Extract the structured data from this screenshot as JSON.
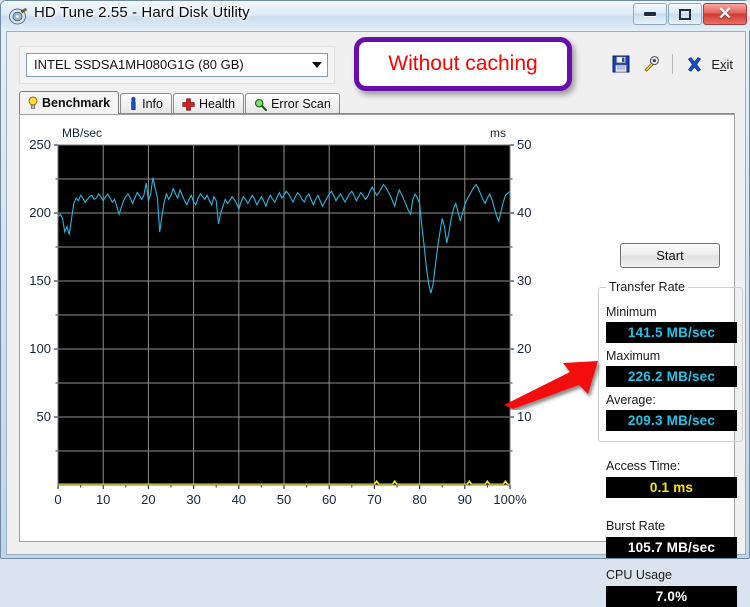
{
  "window": {
    "title": "HD Tune 2.55 - Hard Disk Utility",
    "app_icon": "hard-disk-icon",
    "controls": {
      "minimize": "minimize-icon",
      "maximize": "maximize-icon",
      "close": "✕"
    }
  },
  "toolbar": {
    "drive_selected": "INTEL SSDSA1MH080G1G (80 GB)",
    "save_icon": "floppy-save-icon",
    "tools_icon": "wrench-tools-icon",
    "exit_icon": "close-x-icon",
    "exit_label": "Exit"
  },
  "tabs": [
    {
      "label": "Benchmark",
      "icon": "lightbulb-icon",
      "active": true
    },
    {
      "label": "Info",
      "icon": "info-icon",
      "active": false
    },
    {
      "label": "Health",
      "icon": "red-cross-icon",
      "active": false
    },
    {
      "label": "Error Scan",
      "icon": "magnifier-icon",
      "active": false
    }
  ],
  "actions": {
    "start_label": "Start"
  },
  "stats": {
    "transfer_rate_group": "Transfer Rate",
    "minimum_label": "Minimum",
    "minimum_value": "141.5 MB/sec",
    "maximum_label": "Maximum",
    "maximum_value": "226.2 MB/sec",
    "average_label": "Average:",
    "average_value": "209.3 MB/sec",
    "access_time_label": "Access Time:",
    "access_time_value": "0.1 ms",
    "burst_rate_label": "Burst Rate",
    "burst_rate_value": "105.7 MB/sec",
    "cpu_usage_label": "CPU Usage",
    "cpu_usage_value": "7.0%"
  },
  "annotation": {
    "text": "Without caching",
    "border_color": "#6a0dad",
    "text_color": "#ff0000",
    "arrow_color": "#ff0000",
    "arrow_target": "access-time-value"
  },
  "colors": {
    "transfer_curve": "#29b6dd",
    "access_curve": "#f2e700",
    "plot_background": "#000000",
    "grid": "#8f8f8f",
    "value_cyan": "#22c3e6",
    "value_yellow": "#ffe400",
    "value_white": "#ffffff"
  },
  "chart_data": {
    "type": "line",
    "title": "",
    "xlabel": "",
    "ylabel": "MB/sec",
    "y2label": "ms",
    "xlim": [
      0,
      100
    ],
    "ylim": [
      0,
      250
    ],
    "y2lim": [
      0,
      50
    ],
    "grid": true,
    "x_ticks": [
      0,
      10,
      20,
      30,
      40,
      50,
      60,
      70,
      80,
      90,
      100
    ],
    "x_tick_labels": [
      "0",
      "10",
      "20",
      "30",
      "40",
      "50",
      "60",
      "70",
      "80",
      "90",
      "100%"
    ],
    "y_ticks": [
      50,
      100,
      150,
      200,
      250
    ],
    "y_tick_labels": [
      "50",
      "100",
      "150",
      "200",
      "250"
    ],
    "y2_ticks": [
      10,
      20,
      30,
      40,
      50
    ],
    "y2_tick_labels": [
      "10",
      "20",
      "30",
      "40",
      "50"
    ],
    "series": [
      {
        "name": "Transfer rate",
        "axis": "left",
        "units": "MB/sec",
        "color": "#29b6dd",
        "x": [
          0,
          0.5,
          1,
          1.5,
          2,
          2.5,
          3,
          3.5,
          4,
          4.5,
          5,
          5.5,
          6,
          6.5,
          7,
          7.5,
          8,
          8.5,
          9,
          9.5,
          10,
          10.5,
          11,
          11.5,
          12,
          12.5,
          13,
          13.5,
          14,
          14.5,
          15,
          15.5,
          16,
          16.5,
          17,
          17.5,
          18,
          18.5,
          19,
          19.5,
          20,
          20.5,
          21,
          21.5,
          22,
          22.5,
          23,
          23.5,
          24,
          24.5,
          25,
          25.5,
          26,
          26.5,
          27,
          27.5,
          28,
          28.5,
          29,
          29.5,
          30,
          30.5,
          31,
          31.5,
          32,
          32.5,
          33,
          33.5,
          34,
          34.5,
          35,
          35.5,
          36,
          36.5,
          37,
          37.5,
          38,
          38.5,
          39,
          39.5,
          40,
          40.5,
          41,
          41.5,
          42,
          42.5,
          43,
          43.5,
          44,
          44.5,
          45,
          45.5,
          46,
          46.5,
          47,
          47.5,
          48,
          48.5,
          49,
          49.5,
          50,
          50.5,
          51,
          51.5,
          52,
          52.5,
          53,
          53.5,
          54,
          54.5,
          55,
          55.5,
          56,
          56.5,
          57,
          57.5,
          58,
          58.5,
          59,
          59.5,
          60,
          60.5,
          61,
          61.5,
          62,
          62.5,
          63,
          63.5,
          64,
          64.5,
          65,
          65.5,
          66,
          66.5,
          67,
          67.5,
          68,
          68.5,
          69,
          69.5,
          70,
          70.5,
          71,
          71.5,
          72,
          72.5,
          73,
          73.5,
          74,
          74.5,
          75,
          75.5,
          76,
          76.5,
          77,
          77.5,
          78,
          78.5,
          79,
          79.5,
          80,
          80.5,
          81,
          81.5,
          82,
          82.5,
          83,
          83.5,
          84,
          84.5,
          85,
          85.5,
          86,
          86.5,
          87,
          87.5,
          88,
          88.5,
          89,
          89.5,
          90,
          90.5,
          91,
          91.5,
          92,
          92.5,
          93,
          93.5,
          94,
          94.5,
          95,
          95.5,
          96,
          96.5,
          97,
          97.5,
          98,
          98.5,
          99,
          100
        ],
        "y": [
          197,
          199,
          196,
          186,
          190,
          184,
          196,
          207,
          211,
          209,
          213,
          211,
          208,
          210,
          212,
          213,
          210,
          211,
          214,
          212,
          209,
          212,
          214,
          211,
          208,
          210,
          205,
          199,
          204,
          209,
          212,
          214,
          211,
          207,
          211,
          215,
          213,
          210,
          213,
          222,
          209,
          214,
          226,
          218,
          211,
          186,
          198,
          208,
          214,
          210,
          213,
          218,
          214,
          211,
          217,
          213,
          209,
          206,
          210,
          213,
          208,
          206,
          211,
          214,
          212,
          210,
          213,
          209,
          206,
          212,
          209,
          192,
          200,
          205,
          210,
          207,
          209,
          212,
          210,
          207,
          203,
          208,
          212,
          210,
          207,
          210,
          213,
          210,
          206,
          209,
          212,
          209,
          205,
          210,
          213,
          210,
          208,
          212,
          215,
          211,
          213,
          216,
          214,
          211,
          208,
          212,
          215,
          213,
          210,
          208,
          212,
          214,
          210,
          206,
          210,
          213,
          209,
          205,
          208,
          211,
          214,
          216,
          213,
          209,
          212,
          214,
          211,
          208,
          211,
          214,
          216,
          213,
          209,
          212,
          215,
          213,
          210,
          212,
          216,
          219,
          216,
          213,
          215,
          218,
          221,
          219,
          216,
          213,
          209,
          205,
          212,
          217,
          214,
          210,
          206,
          202,
          199,
          210,
          214,
          211,
          207,
          190,
          176,
          160,
          148,
          141,
          148,
          162,
          175,
          186,
          196,
          190,
          178,
          186,
          196,
          203,
          207,
          201,
          194,
          200,
          206,
          210,
          213,
          216,
          219,
          221,
          218,
          214,
          210,
          207,
          211,
          214,
          210,
          204,
          198,
          194,
          201,
          208,
          213,
          216
        ]
      },
      {
        "name": "Access time",
        "axis": "right",
        "units": "ms",
        "color": "#f2e700",
        "value_constant": 0.1,
        "note": "Flat trace at the baseline of the right-hand ms axis (~0.1 ms) with small spikes."
      }
    ],
    "summary": {
      "minimum_mb_s": 141.5,
      "maximum_mb_s": 226.2,
      "average_mb_s": 209.3,
      "access_time_ms": 0.1,
      "burst_rate_mb_s": 105.7,
      "cpu_usage_percent": 7.0
    }
  }
}
